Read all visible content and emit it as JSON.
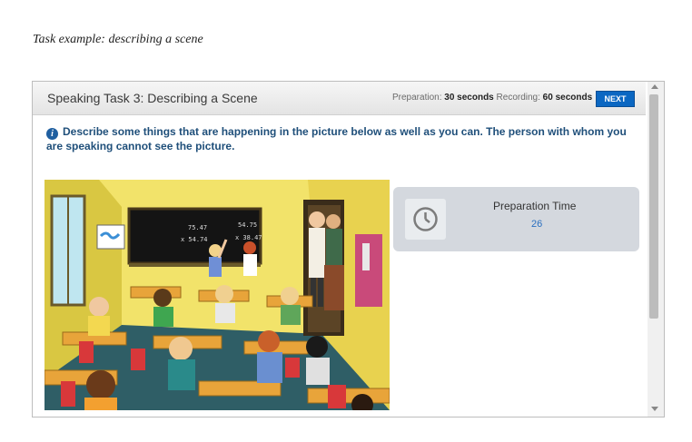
{
  "caption": "Task example: describing a scene",
  "header": {
    "title": "Speaking Task 3: Describing a Scene",
    "prep_label": "Preparation:",
    "prep_value": "30 seconds",
    "rec_label": "Recording:",
    "rec_value": "60 seconds",
    "next_label": "NEXT"
  },
  "instruction": "Describe some things that are happening in the picture below as well as you can. The person with whom you are speaking cannot see the picture.",
  "prep_panel": {
    "title": "Preparation Time",
    "countdown": "26",
    "icon": "clock-icon"
  },
  "scene": {
    "board_text": [
      "75.47",
      "54.75",
      "x 54.74",
      "x 38.47"
    ]
  },
  "colors": {
    "accent": "#0b67c2",
    "instruction_text": "#1f4f7a",
    "panel_bg": "#d4d8de"
  }
}
